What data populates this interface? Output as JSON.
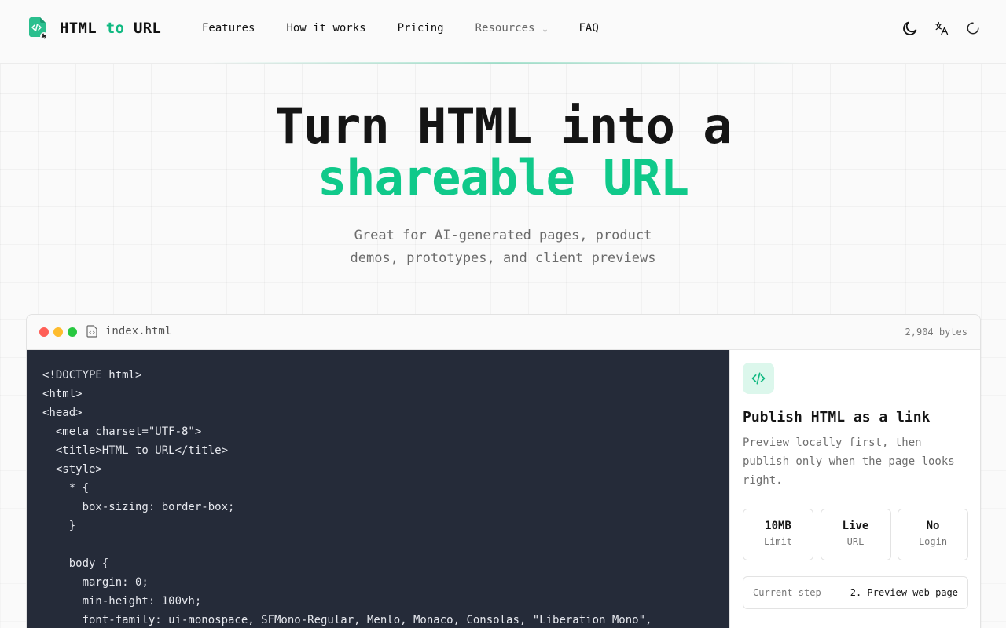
{
  "brand": {
    "name_part1": "HTML",
    "name_part2": "to",
    "name_part3": "URL",
    "accent": "#10b981"
  },
  "nav": {
    "features": "Features",
    "how_it_works": "How it works",
    "pricing": "Pricing",
    "resources": "Resources",
    "faq": "FAQ"
  },
  "header_icons": [
    "moon-icon",
    "translate-icon",
    "loading-spinner-icon"
  ],
  "hero": {
    "title_line1": "Turn HTML into a",
    "title_line2": "shareable URL",
    "subtitle": "Great for AI-generated pages, product demos, prototypes, and client previews"
  },
  "editor": {
    "file_name": "index.html",
    "bytes": "2,904 bytes",
    "code": "<!DOCTYPE html>\n<html>\n<head>\n  <meta charset=\"UTF-8\">\n  <title>HTML to URL</title>\n  <style>\n    * {\n      box-sizing: border-box;\n    }\n\n    body {\n      margin: 0;\n      min-height: 100vh;\n      font-family: ui-monospace, SFMono-Regular, Menlo, Monaco, Consolas, \"Liberation Mono\","
  },
  "panel": {
    "title": "Publish HTML as a link",
    "description": "Preview locally first, then publish only when the page looks right.",
    "stats": [
      {
        "value": "10MB",
        "label": "Limit"
      },
      {
        "value": "Live",
        "label": "URL"
      },
      {
        "value": "No",
        "label": "Login"
      }
    ],
    "current_step_label": "Current step",
    "current_step_value": "2. Preview web page"
  }
}
